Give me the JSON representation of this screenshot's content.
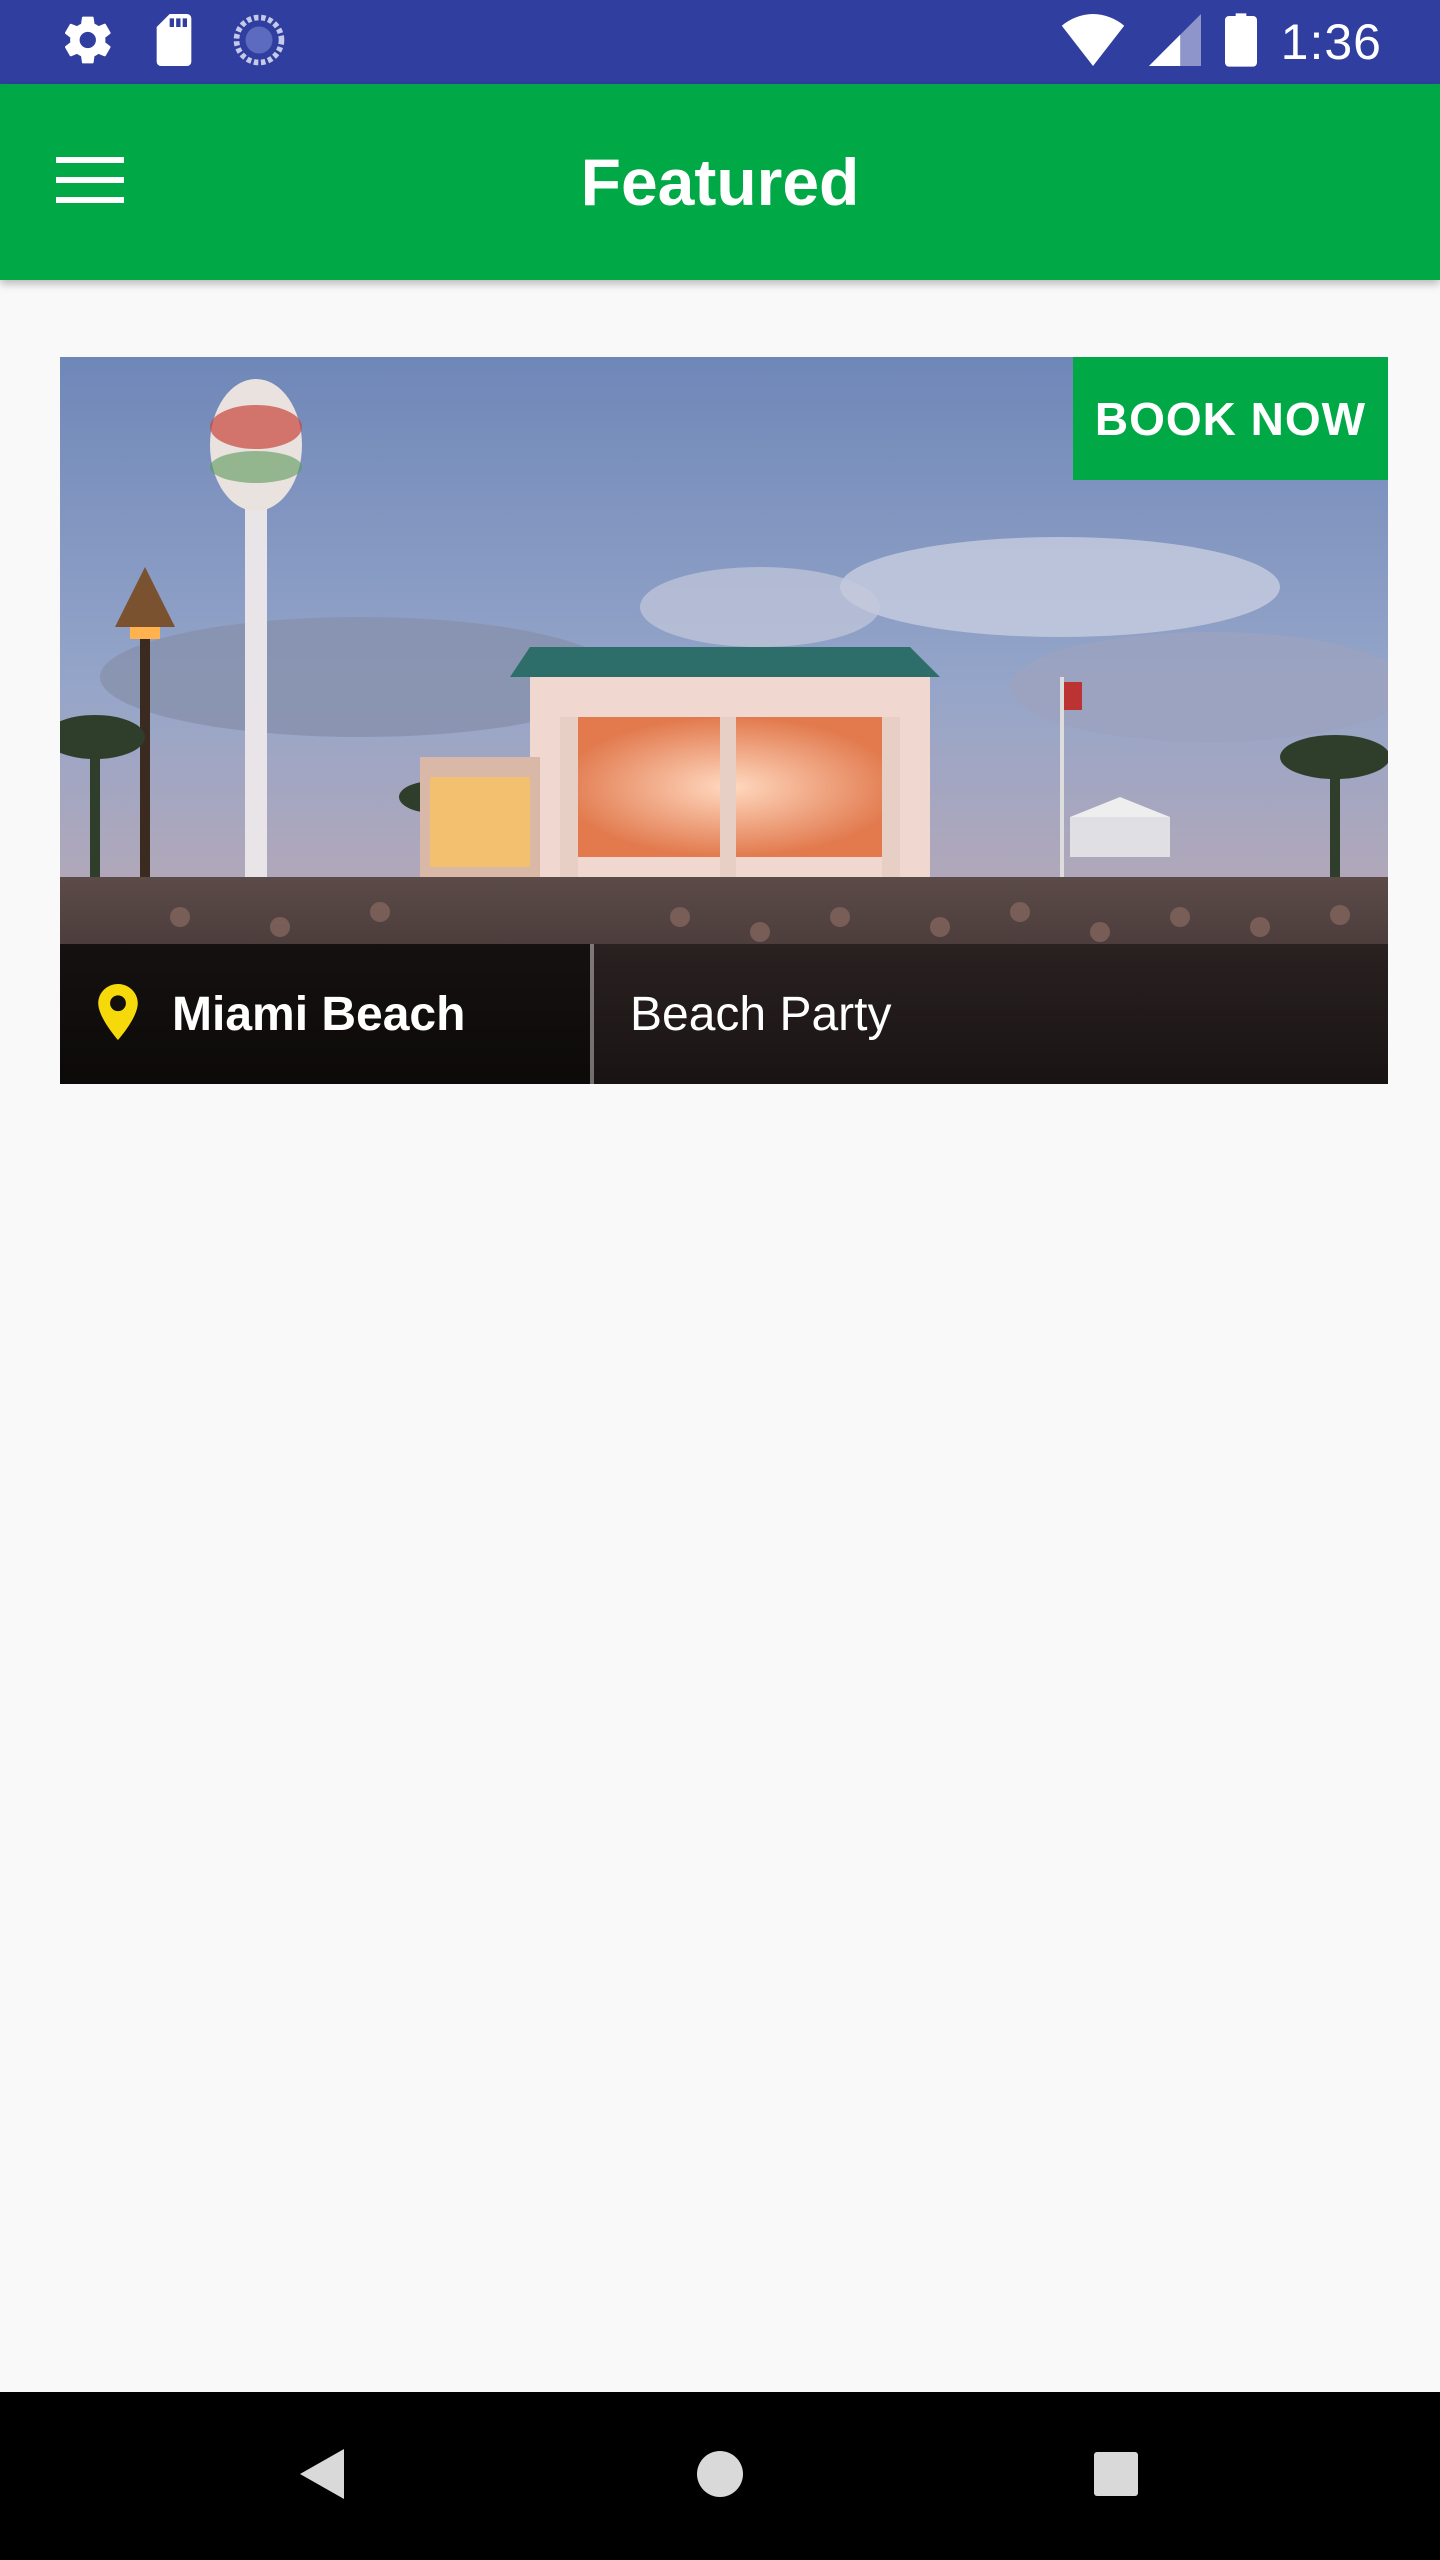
{
  "status_bar": {
    "time": "1:36",
    "icons_left": [
      "settings-icon",
      "sd-card-icon",
      "sync-icon"
    ],
    "icons_right": [
      "wifi-icon",
      "signal-icon",
      "battery-icon"
    ]
  },
  "app_bar": {
    "title": "Featured",
    "menu_icon": "menu-icon",
    "color": "#00a846"
  },
  "featured_card": {
    "book_label": "BOOK NOW",
    "location": "Miami Beach",
    "event_title": "Beach Party",
    "location_icon": "location-pin-icon",
    "pin_color": "#f5d90a"
  },
  "nav_bar": {
    "buttons": [
      "back-icon",
      "home-icon",
      "recents-icon"
    ]
  },
  "colors": {
    "status_bar": "#303f9f",
    "accent": "#00a846",
    "background": "#f9f9f9"
  }
}
